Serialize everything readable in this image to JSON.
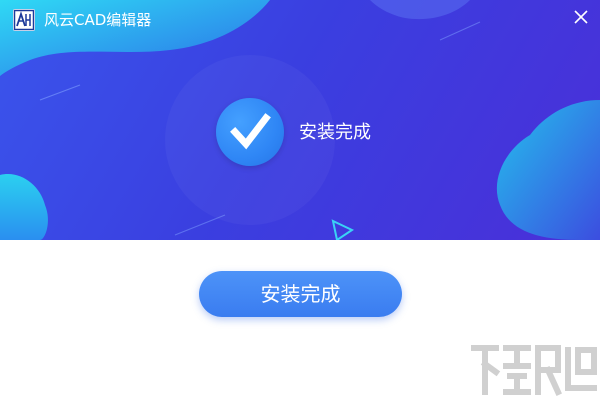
{
  "window": {
    "title": "风云CAD编辑器",
    "logo_icon": "app-logo-icon",
    "close_icon": "close-icon"
  },
  "install": {
    "status_text": "安装完成",
    "status_icon": "checkmark-icon",
    "finish_button_label": "安装完成"
  },
  "colors": {
    "hero_start": "#3a55ec",
    "hero_end": "#4a2fd8",
    "accent_cyan": "#2ad6f0",
    "button": "#3f85f3",
    "check_circle": "#2f86f5"
  },
  "watermark": {
    "icon": "download-site-watermark"
  }
}
